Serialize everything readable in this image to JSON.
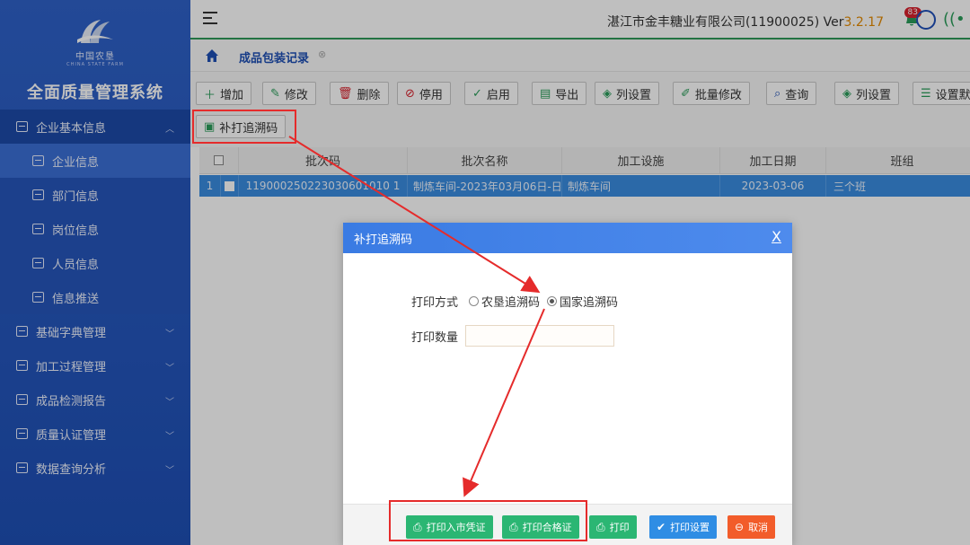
{
  "sidebar": {
    "logo_cn": "中国农垦",
    "logo_en": "CHINA STATE FARM",
    "system_title": "全面质量管理系统",
    "items": [
      {
        "label": "企业基本信息",
        "type": "group-open"
      },
      {
        "label": "企业信息",
        "type": "sub"
      },
      {
        "label": "部门信息",
        "type": "sub"
      },
      {
        "label": "岗位信息",
        "type": "sub"
      },
      {
        "label": "人员信息",
        "type": "sub"
      },
      {
        "label": "信息推送",
        "type": "sub"
      },
      {
        "label": "基础字典管理",
        "type": "group"
      },
      {
        "label": "加工过程管理",
        "type": "group"
      },
      {
        "label": "成品检测报告",
        "type": "group"
      },
      {
        "label": "质量认证管理",
        "type": "group"
      },
      {
        "label": "数据查询分析",
        "type": "group"
      }
    ]
  },
  "header": {
    "company": "湛江市金丰糖业有限公司(11900025) Ver",
    "version": "3.2.17",
    "notify_count": "83"
  },
  "tab": {
    "title": "成品包装记录",
    "close": "⊗"
  },
  "toolbar": {
    "add": "增加",
    "edit": "修改",
    "delete": "删除",
    "disable": "停用",
    "enable": "启用",
    "export": "导出",
    "columns": "列设置",
    "batch_edit": "批量修改",
    "query": "查询",
    "columns2": "列设置",
    "set_default": "设置默",
    "reprint": "补打追溯码"
  },
  "grid": {
    "headers": [
      "批次码",
      "批次名称",
      "加工设施",
      "加工日期",
      "班组"
    ],
    "rows": [
      {
        "index": "1",
        "batch_code": "119000250223030601010 1",
        "batch_name": "制炼车间-2023年03月06日-日",
        "facility": "制炼车间",
        "date": "2023-03-06",
        "team": "三个班"
      }
    ]
  },
  "dialog": {
    "title": "补打追溯码",
    "close": "X",
    "print_mode_label": "打印方式",
    "option_1": "农垦追溯码",
    "option_2": "国家追溯码",
    "qty_label": "打印数量",
    "qty_value": "",
    "btn_market": "打印入市凭证",
    "btn_cert": "打印合格证",
    "btn_print": "打印",
    "btn_settings": "打印设置",
    "btn_cancel": "取消"
  },
  "colors": {
    "sidebar": "#2f62c9",
    "accent_green": "#2bb673",
    "accent_blue": "#2f8de4",
    "cancel": "#f25c2a",
    "annotation": "#e52b2b"
  }
}
